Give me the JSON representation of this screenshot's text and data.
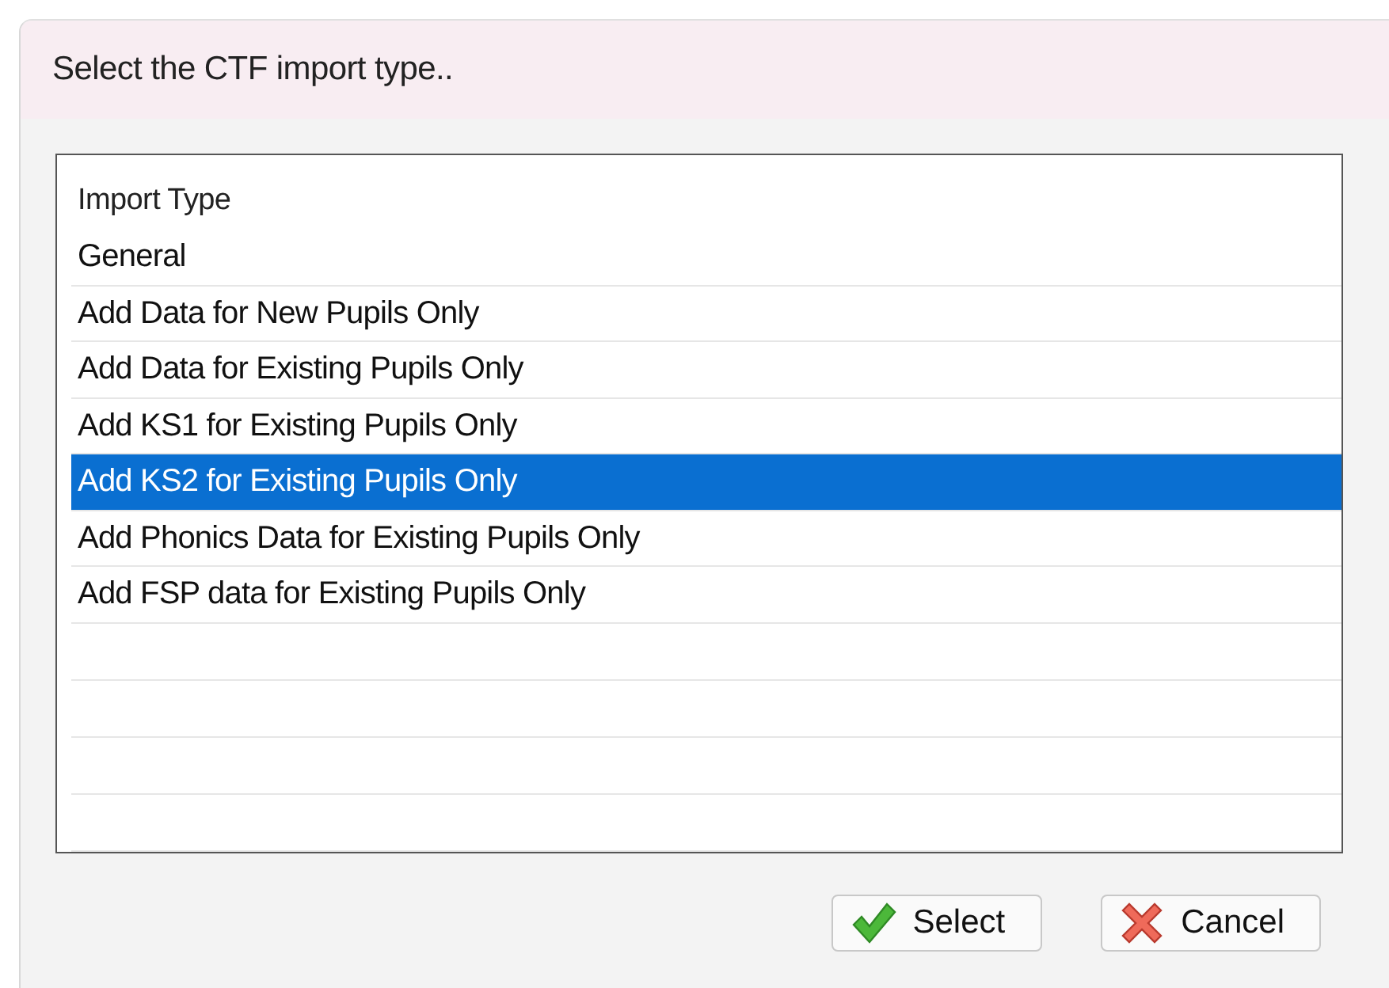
{
  "window": {
    "title": "Select the CTF import type.."
  },
  "list": {
    "columns": [
      "Import Type"
    ],
    "rows": [
      {
        "label": "General",
        "selected": false
      },
      {
        "label": "Add Data for New Pupils Only",
        "selected": false
      },
      {
        "label": "Add Data for Existing Pupils Only",
        "selected": false
      },
      {
        "label": "Add KS1 for Existing Pupils Only",
        "selected": false
      },
      {
        "label": "Add KS2 for Existing Pupils Only",
        "selected": true
      },
      {
        "label": "Add Phonics Data for Existing Pupils Only",
        "selected": false
      },
      {
        "label": "Add FSP data for Existing Pupils Only",
        "selected": false
      }
    ]
  },
  "buttons": [
    {
      "label": "Select",
      "kind": "ok"
    },
    {
      "label": "Cancel",
      "kind": "cancel"
    }
  ]
}
